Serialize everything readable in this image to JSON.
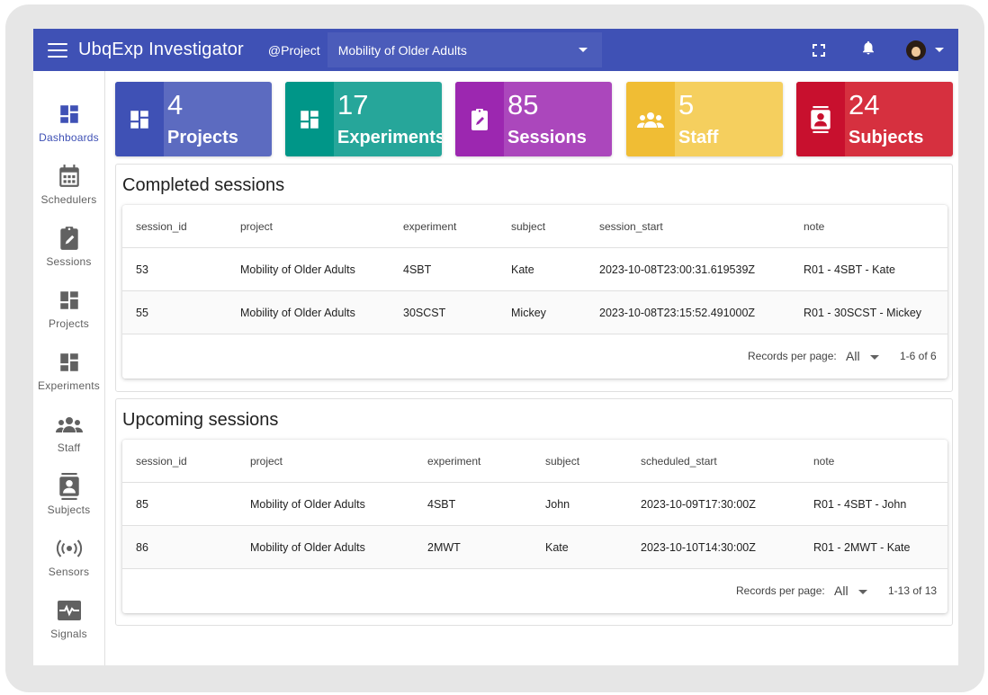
{
  "appbar": {
    "title": "UbqExp Investigator",
    "project_tag": "@Project",
    "project_selected": "Mobility of Older Adults",
    "icons": [
      "menu-icon",
      "fullscreen-icon",
      "bell-icon",
      "avatar",
      "chevron-down-icon"
    ]
  },
  "sidebar": {
    "items": [
      {
        "label": "Dashboards",
        "icon": "dashboard-icon"
      },
      {
        "label": "Schedulers",
        "icon": "calendar-icon"
      },
      {
        "label": "Sessions",
        "icon": "clipboard-edit-icon"
      },
      {
        "label": "Projects",
        "icon": "dashboard-icon"
      },
      {
        "label": "Experiments",
        "icon": "dashboard-icon"
      },
      {
        "label": "Staff",
        "icon": "people-icon"
      },
      {
        "label": "Subjects",
        "icon": "contact-card-icon"
      },
      {
        "label": "Sensors",
        "icon": "sensor-icon"
      },
      {
        "label": "Signals",
        "icon": "monitor-heart-icon"
      }
    ],
    "active": "Dashboards"
  },
  "cards": [
    {
      "value": "4",
      "label": "Projects",
      "color": "#5c6bc0",
      "side_color": "#3f51b5",
      "icon": "dashboard-icon"
    },
    {
      "value": "17",
      "label": "Experiments",
      "color": "#26a69a",
      "side_color": "#009688",
      "icon": "dashboard-icon"
    },
    {
      "value": "85",
      "label": "Sessions",
      "color": "#ab47bc",
      "side_color": "#9c27b0",
      "icon": "clipboard-edit-icon"
    },
    {
      "value": "5",
      "label": "Staff",
      "color": "#f5cf5e",
      "side_color": "#f0bd34",
      "icon": "people-icon"
    },
    {
      "value": "24",
      "label": "Subjects",
      "color": "#d6303f",
      "side_color": "#c8102e",
      "icon": "contact-card-icon"
    }
  ],
  "completed": {
    "title": "Completed sessions",
    "columns": [
      "session_id",
      "project",
      "experiment",
      "subject",
      "session_start",
      "note"
    ],
    "rows": [
      [
        "53",
        "Mobility of Older Adults",
        "4SBT",
        "Kate",
        "2023-10-08T23:00:31.619539Z",
        "R01 - 4SBT - Kate"
      ],
      [
        "55",
        "Mobility of Older Adults",
        "30SCST",
        "Mickey",
        "2023-10-08T23:15:52.491000Z",
        "R01 - 30SCST - Mickey"
      ]
    ],
    "records_per_page_label": "Records per page:",
    "records_per_page": "All",
    "range": "1-6 of 6"
  },
  "upcoming": {
    "title": "Upcoming sessions",
    "columns": [
      "session_id",
      "project",
      "experiment",
      "subject",
      "scheduled_start",
      "note"
    ],
    "rows": [
      [
        "85",
        "Mobility of Older Adults",
        "4SBT",
        "John",
        "2023-10-09T17:30:00Z",
        "R01 - 4SBT - John"
      ],
      [
        "86",
        "Mobility of Older Adults",
        "2MWT",
        "Kate",
        "2023-10-10T14:30:00Z",
        "R01 - 2MWT - Kate"
      ]
    ],
    "records_per_page_label": "Records per page:",
    "records_per_page": "All",
    "range": "1-13 of 13"
  }
}
